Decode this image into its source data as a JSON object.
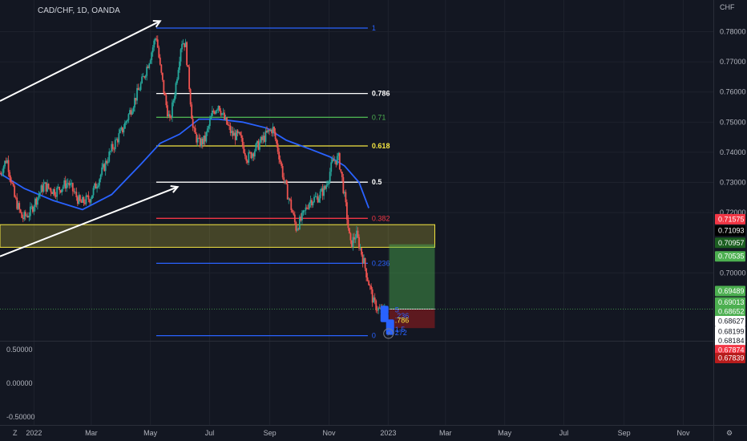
{
  "header": {
    "symbol_line": "CAD/CHF, 1D, OANDA",
    "currency": "CHF"
  },
  "chart_data": {
    "type": "candlestick",
    "title": "CAD/CHF, 1D, OANDA",
    "ylabel": "CHF",
    "ylim": [
      0.6775,
      0.7905
    ],
    "y_ticks": [
      "0.78000",
      "0.77000",
      "0.76000",
      "0.75000",
      "0.74000",
      "0.73000",
      "0.72000",
      "0.70000"
    ],
    "x_ticks": [
      {
        "label": "2022",
        "day": 0
      },
      {
        "label": "Mar",
        "day": 59
      },
      {
        "label": "May",
        "day": 120
      },
      {
        "label": "Jul",
        "day": 181
      },
      {
        "label": "Sep",
        "day": 243
      },
      {
        "label": "Nov",
        "day": 304
      },
      {
        "label": "2023",
        "day": 365
      },
      {
        "label": "Mar",
        "day": 424
      },
      {
        "label": "May",
        "day": 485
      },
      {
        "label": "Jul",
        "day": 546
      },
      {
        "label": "Sep",
        "day": 608
      },
      {
        "label": "Nov",
        "day": 669
      }
    ],
    "x_range_days": [
      -35,
      700
    ],
    "price_path": [
      [
        -35,
        0.733
      ],
      [
        -28,
        0.738
      ],
      [
        -20,
        0.725
      ],
      [
        -12,
        0.718
      ],
      [
        -4,
        0.72
      ],
      [
        0,
        0.723
      ],
      [
        10,
        0.729
      ],
      [
        22,
        0.727
      ],
      [
        35,
        0.73
      ],
      [
        48,
        0.723
      ],
      [
        58,
        0.725
      ],
      [
        68,
        0.732
      ],
      [
        80,
        0.741
      ],
      [
        92,
        0.748
      ],
      [
        102,
        0.756
      ],
      [
        112,
        0.764
      ],
      [
        120,
        0.772
      ],
      [
        126,
        0.779
      ],
      [
        130,
        0.768
      ],
      [
        136,
        0.756
      ],
      [
        140,
        0.75
      ],
      [
        146,
        0.762
      ],
      [
        152,
        0.777
      ],
      [
        156,
        0.776
      ],
      [
        160,
        0.762
      ],
      [
        164,
        0.747
      ],
      [
        170,
        0.743
      ],
      [
        176,
        0.744
      ],
      [
        184,
        0.753
      ],
      [
        190,
        0.756
      ],
      [
        196,
        0.751
      ],
      [
        204,
        0.746
      ],
      [
        212,
        0.745
      ],
      [
        220,
        0.738
      ],
      [
        230,
        0.742
      ],
      [
        240,
        0.746
      ],
      [
        246,
        0.748
      ],
      [
        252,
        0.74
      ],
      [
        258,
        0.73
      ],
      [
        264,
        0.723
      ],
      [
        270,
        0.715
      ],
      [
        276,
        0.718
      ],
      [
        284,
        0.724
      ],
      [
        292,
        0.725
      ],
      [
        300,
        0.728
      ],
      [
        308,
        0.737
      ],
      [
        314,
        0.738
      ],
      [
        318,
        0.73
      ],
      [
        322,
        0.72
      ],
      [
        326,
        0.709
      ],
      [
        332,
        0.713
      ],
      [
        338,
        0.706
      ],
      [
        344,
        0.698
      ],
      [
        350,
        0.69
      ],
      [
        355,
        0.688
      ],
      [
        359,
        0.687
      ],
      [
        362,
        0.6885
      ]
    ],
    "moving_average": [
      [
        -35,
        0.733
      ],
      [
        -10,
        0.728
      ],
      [
        20,
        0.724
      ],
      [
        50,
        0.721
      ],
      [
        80,
        0.726
      ],
      [
        110,
        0.736
      ],
      [
        130,
        0.743
      ],
      [
        150,
        0.746
      ],
      [
        170,
        0.751
      ],
      [
        190,
        0.751
      ],
      [
        215,
        0.75
      ],
      [
        240,
        0.748
      ],
      [
        260,
        0.744
      ],
      [
        285,
        0.741
      ],
      [
        305,
        0.7385
      ],
      [
        320,
        0.7355
      ],
      [
        335,
        0.73
      ],
      [
        345,
        0.7215
      ]
    ],
    "fib_levels": [
      {
        "label": "1",
        "price": 0.7812,
        "color": "#2962ff",
        "x_from": 126,
        "x_to": 344
      },
      {
        "label": "0.786",
        "price": 0.7595,
        "color": "#ffffff",
        "x_from": 126,
        "x_to": 344
      },
      {
        "label": "0.71",
        "price": 0.7516,
        "color": "#4caf50",
        "x_from": 126,
        "x_to": 344
      },
      {
        "label": "0.618",
        "price": 0.7421,
        "color": "#f5e642",
        "x_from": 126,
        "x_to": 344
      },
      {
        "label": "0.5",
        "price": 0.7301,
        "color": "#ffffff",
        "x_from": 126,
        "x_to": 344
      },
      {
        "label": "0.382",
        "price": 0.7181,
        "color": "#f23645",
        "x_from": 126,
        "x_to": 344
      },
      {
        "label": "0.236",
        "price": 0.7032,
        "color": "#2962ff",
        "x_from": 126,
        "x_to": 344
      },
      {
        "label": "0",
        "price": 0.6792,
        "color": "#2962ff",
        "x_from": 126,
        "x_to": 344
      }
    ],
    "zone": {
      "from_day": -35,
      "to_day": 413,
      "top": 0.716,
      "bottom": 0.7085
    },
    "arrows": [
      {
        "from": [
          -35,
          0.757
        ],
        "to": [
          130,
          0.7835
        ]
      },
      {
        "from": [
          -35,
          0.7055
        ],
        "to": [
          148,
          0.7285
        ]
      }
    ],
    "position": {
      "from_day": 366,
      "to_day": 413,
      "entry": 0.688,
      "target": 0.7095,
      "stop": 0.6817
    },
    "small_labels": [
      "5",
      ".236",
      ".786",
      "1.5",
      "272"
    ],
    "price_badges": [
      {
        "value": "0.71575",
        "price": 0.7178,
        "bg": "#f23645",
        "fg": "#ffffff"
      },
      {
        "value": "0.71093",
        "price": 0.714,
        "bg": "#000000",
        "fg": "#ffffff"
      },
      {
        "value": "0.70957",
        "price": 0.71,
        "bg": "#1b5e20",
        "fg": "#ffffff"
      },
      {
        "value": "0.70535",
        "price": 0.7055,
        "bg": "#4caf50",
        "fg": "#ffffff"
      },
      {
        "value": "0.69489",
        "price": 0.694,
        "bg": "#4caf50",
        "fg": "#ffffff"
      },
      {
        "value": "0.69013",
        "price": 0.6902,
        "bg": "#4caf50",
        "fg": "#ffffff"
      },
      {
        "value": "0.68652",
        "price": 0.6872,
        "bg": "#4caf50",
        "fg": "#ffffff"
      },
      {
        "value": "0.68627",
        "price": 0.684,
        "bg": "#ffffff",
        "fg": "#131722"
      },
      {
        "value": "0.68199",
        "price": 0.6806,
        "bg": "#ffffff",
        "fg": "#131722"
      },
      {
        "value": "0.68184",
        "price": 0.6775,
        "bg": "#ffffff",
        "fg": "#131722"
      },
      {
        "value": "0.67874",
        "price": 0.6744,
        "bg": "#f23645",
        "fg": "#ffffff"
      },
      {
        "value": "0.67839",
        "price": 0.6718,
        "bg": "#b71c1c",
        "fg": "#ffffff"
      }
    ],
    "sub_pane": {
      "ticks": [
        "0.50000",
        "0.00000",
        "-0.50000"
      ],
      "values": [
        0.5,
        0.0,
        -0.5
      ]
    },
    "grid": true,
    "legend": "none"
  }
}
